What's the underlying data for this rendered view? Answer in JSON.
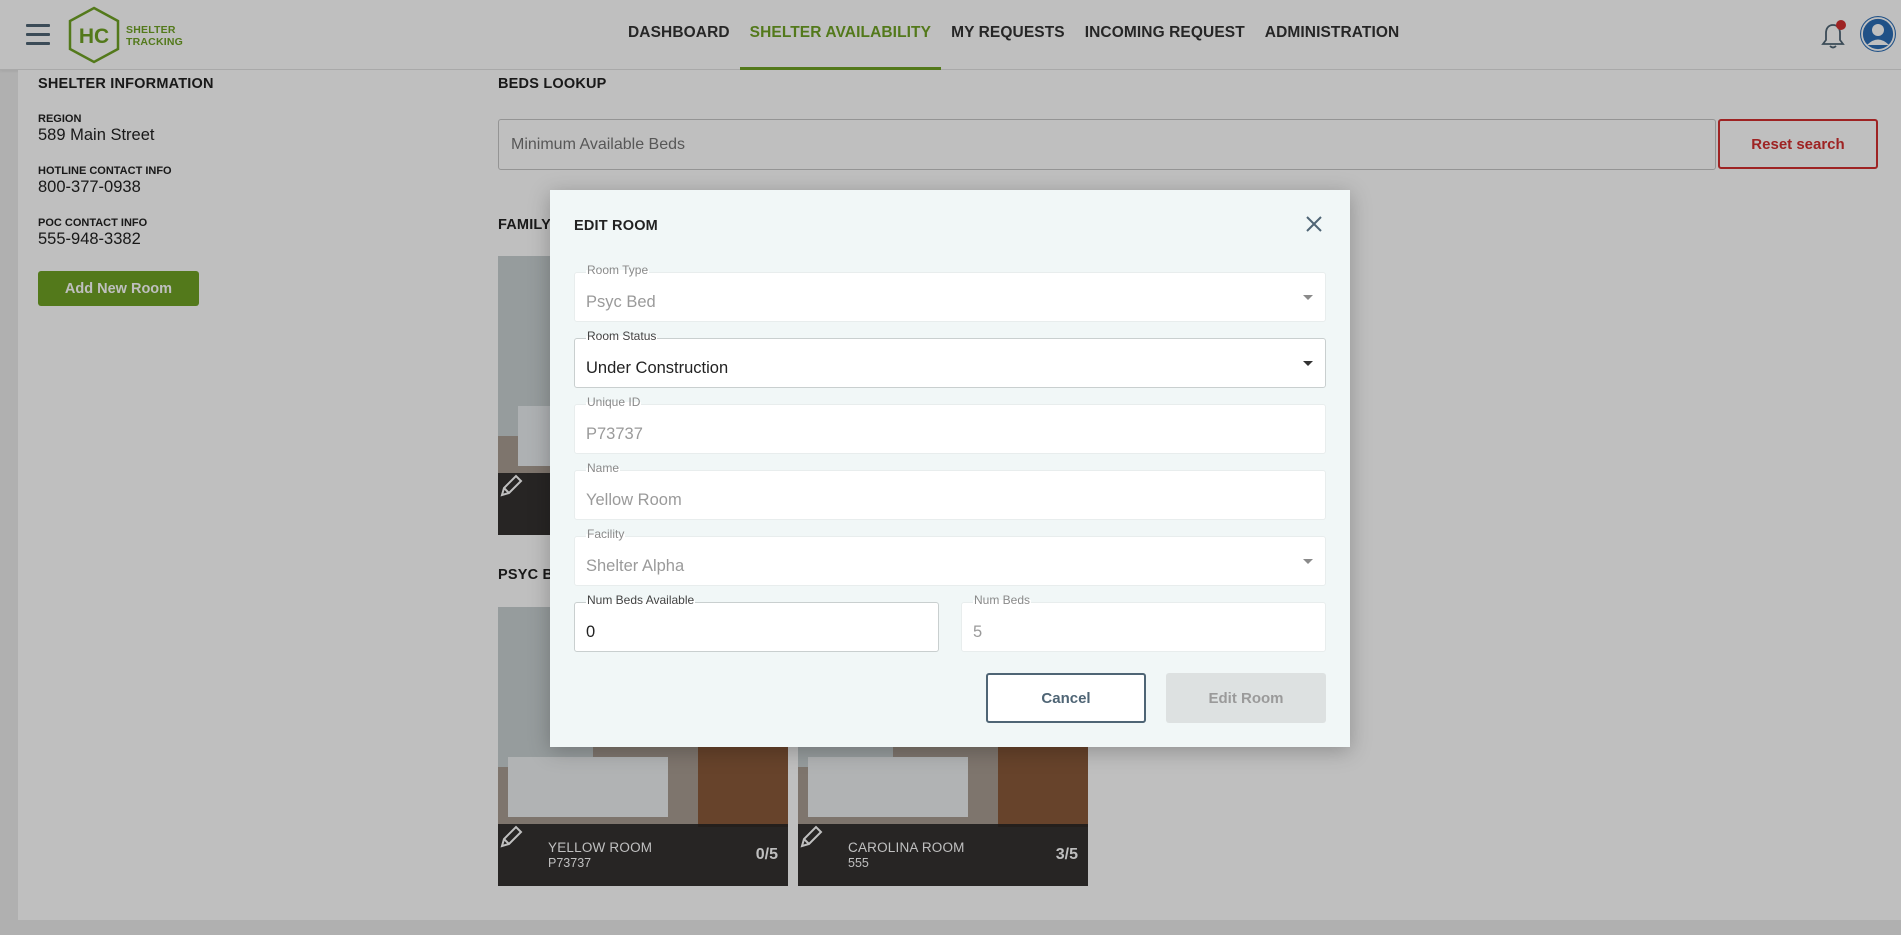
{
  "header": {
    "logo_line1": "SHELTER",
    "logo_line2": "TRACKING",
    "logo_mark": "HC",
    "nav": [
      {
        "label": "DASHBOARD"
      },
      {
        "label": "SHELTER AVAILABILITY",
        "active": true
      },
      {
        "label": "MY REQUESTS"
      },
      {
        "label": "INCOMING REQUEST"
      },
      {
        "label": "ADMINISTRATION"
      }
    ],
    "accent_color": "#6fa224",
    "notification_color": "#d32f2f"
  },
  "shelter_info": {
    "title": "SHELTER INFORMATION",
    "region_label": "REGION",
    "region_value": "589 Main Street",
    "hotline_label": "HOTLINE CONTACT INFO",
    "hotline_value": "800-377-0938",
    "poc_label": "POC CONTACT INFO",
    "poc_value": "555-948-3382",
    "add_room_label": "Add New Room"
  },
  "beds_lookup": {
    "title": "BEDS LOOKUP",
    "placeholder": "Minimum Available Beds",
    "reset_label": "Reset search"
  },
  "sections": {
    "family_title": "FAMILY",
    "psyc_title": "PSYC B"
  },
  "cards": [
    {
      "name": "YELLOW ROOM",
      "id": "P73737",
      "count": "0/5"
    },
    {
      "name": "CAROLINA ROOM",
      "id": "555",
      "count": "3/5"
    }
  ],
  "modal": {
    "title": "EDIT ROOM",
    "room_type_label": "Room Type",
    "room_type_value": "Psyc Bed",
    "room_status_label": "Room Status",
    "room_status_value": "Under Construction",
    "unique_id_label": "Unique ID",
    "unique_id_value": "P73737",
    "name_label": "Name",
    "name_value": "Yellow Room",
    "facility_label": "Facility",
    "facility_value": "Shelter Alpha",
    "beds_available_label": "Num Beds Available",
    "beds_available_value": "0",
    "num_beds_label": "Num Beds",
    "num_beds_value": "5",
    "cancel_label": "Cancel",
    "edit_label": "Edit Room"
  }
}
